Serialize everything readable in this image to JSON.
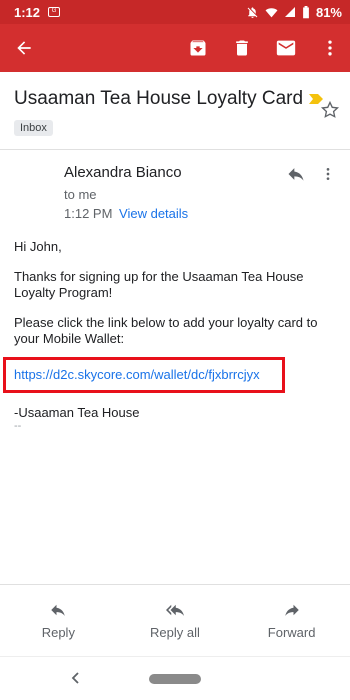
{
  "status": {
    "time": "1:12",
    "battery": "81%"
  },
  "email": {
    "subject": "Usaaman Tea House Loyalty Card",
    "label": "Inbox",
    "sender": "Alexandra Bianco",
    "to": "to me",
    "time": "1:12 PM",
    "view_details": "View details"
  },
  "body": {
    "greeting": "Hi John,",
    "para1": "Thanks for signing up for the Usaaman Tea House Loyalty Program!",
    "para2": "Please click the link below to add your loyalty  card to your Mobile Wallet:",
    "link": "https://d2c.skycore.com/wallet/dc/fjxbrrcjyx",
    "signature": "-Usaaman Tea House",
    "quoted": "--"
  },
  "actions": {
    "reply": "Reply",
    "reply_all": "Reply all",
    "forward": "Forward"
  },
  "colors": {
    "app_bar": "#d32f2f",
    "status_bar": "#c62828",
    "link": "#1a73e8",
    "highlight": "#e8101a"
  }
}
